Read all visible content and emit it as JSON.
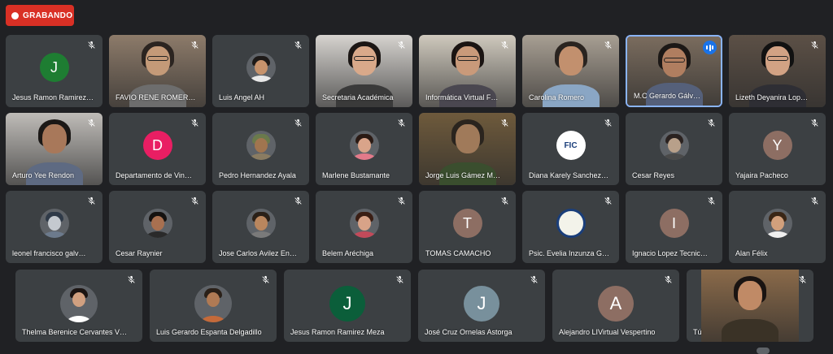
{
  "recording": {
    "label": "GRABANDO"
  },
  "participants": [
    {
      "name": "Jesus Ramon Ramirez Meza",
      "display": "Jesus Ramon Ramirez…",
      "kind": "initial",
      "initial": "J",
      "color": "#1e7d32"
    },
    {
      "name": "FAVIO RENE ROMERO",
      "display": "FAVIO RENE ROMER…",
      "kind": "video",
      "bg": "#8d7b6a",
      "skin": "#c49a78",
      "hair": "#2b2420",
      "shirt": "#6d6d6d",
      "glasses": true
    },
    {
      "name": "Luis Angel AH",
      "display": "Luis Angel AH",
      "kind": "photo",
      "skin": "#c7936c",
      "hair": "#1e1a18",
      "shirt": "#e8e8e8"
    },
    {
      "name": "Secretaria Académica",
      "display": "Secretaria Académica",
      "kind": "video",
      "bg": "#d6d3cf",
      "skin": "#d9a98a",
      "hair": "#1b1614",
      "shirt": "#3a3a3a",
      "glasses": true
    },
    {
      "name": "Informática Virtual F",
      "display": "Informática Virtual F…",
      "kind": "video",
      "bg": "#cfc9bd",
      "skin": "#c99a7a",
      "hair": "#1a1412",
      "shirt": "#4a4750",
      "glasses": true
    },
    {
      "name": "Carolina Romero",
      "display": "Carolina Romero",
      "kind": "video",
      "bg": "#a89f93",
      "skin": "#c2906e",
      "hair": "#2a2420",
      "shirt": "#8aa6c4",
      "glasses": false
    },
    {
      "name": "M.C Gerardo Gálvez",
      "display": "M.C Gerardo Gálv…",
      "kind": "video",
      "bg": "#7a6c5e",
      "skin": "#b07e60",
      "hair": "#1c1816",
      "shirt": "#55607a",
      "glasses": true,
      "speaking": true
    },
    {
      "name": "Lizeth Deyanira Lopez",
      "display": "Lizeth Deyanira Lop…",
      "kind": "video",
      "bg": "#5c5046",
      "skin": "#d2a284",
      "hair": "#111",
      "shirt": "#2e2e34",
      "glasses": true
    },
    {
      "name": "Arturo Yee Rendon",
      "display": "Arturo Yee Rendon",
      "kind": "video",
      "bg": "#bfbcb8",
      "skin": "#a8785a",
      "hair": "#1b1816",
      "shirt": "#5e6a82",
      "glasses": false
    },
    {
      "name": "Departamento de Vinculación",
      "display": "Departamento de Vin…",
      "kind": "initial",
      "initial": "D",
      "color": "#e91e63"
    },
    {
      "name": "Pedro Hernandez Ayala",
      "display": "Pedro Hernandez Ayala",
      "kind": "photo",
      "skin": "#a0754f",
      "hair": "#6a7a4c",
      "shirt": "#8a7c62"
    },
    {
      "name": "Marlene Bustamante",
      "display": "Marlene Bustamante",
      "kind": "photo",
      "skin": "#d9a48a",
      "hair": "#2a1a14",
      "shirt": "#e37a8a"
    },
    {
      "name": "Jorge Luis Gámez M",
      "display": "Jorge Luis Gámez M…",
      "kind": "video",
      "bg": "#6e5a3c",
      "skin": "#a07a5a",
      "hair": "#2a241e",
      "shirt": "#3a4e2e",
      "glasses": false
    },
    {
      "name": "Diana Karely Sanchez",
      "display": "Diana Karely Sanchez…",
      "kind": "logo",
      "text": "FIC"
    },
    {
      "name": "Cesar Reyes",
      "display": "Cesar Reyes",
      "kind": "photo",
      "skin": "#b8a08a",
      "hair": "#2a2220",
      "shirt": "#4a4a4a"
    },
    {
      "name": "Yajaira Pacheco",
      "display": "Yajaira Pacheco",
      "kind": "initial",
      "initial": "Y",
      "color": "#8d6e63"
    },
    {
      "name": "leonel francisco galvez",
      "display": "leonel francisco galv…",
      "kind": "photo",
      "skin": "#c4c9cf",
      "hair": "#2f3a48",
      "shirt": "#6c7a8c"
    },
    {
      "name": "Cesar Raynier",
      "display": "Cesar Raynier",
      "kind": "photo",
      "skin": "#a87050",
      "hair": "#151210",
      "shirt": "#2a2a2a"
    },
    {
      "name": "Jose Carlos Avilez Enriquez",
      "display": "Jose Carlos Avilez En…",
      "kind": "photo",
      "skin": "#b9865e",
      "hair": "#2a2018",
      "shirt": "#7a7a7a"
    },
    {
      "name": "Belem Aréchiga",
      "display": "Belem Aréchiga",
      "kind": "photo",
      "skin": "#d8a388",
      "hair": "#3a1e14",
      "shirt": "#c24a5a"
    },
    {
      "name": "TOMAS CAMACHO",
      "display": "TOMAS CAMACHO",
      "kind": "initial",
      "initial": "T",
      "color": "#8d6e63"
    },
    {
      "name": "Psic. Evelia Inzunza G",
      "display": "Psic. Evelia Inzunza G…",
      "kind": "seal",
      "text": ""
    },
    {
      "name": "Ignacio Lopez Tecnico",
      "display": "Ignacio Lopez Tecnic…",
      "kind": "initial",
      "initial": "I",
      "color": "#8d6e63"
    },
    {
      "name": "Alan Félix",
      "display": "Alan Félix",
      "kind": "photo",
      "skin": "#d2a07c",
      "hair": "#3a2616",
      "shirt": "#efefef"
    },
    {
      "name": "Thelma Berenice Cervantes V",
      "display": "Thelma Berenice Cervantes V…",
      "kind": "photo",
      "skin": "#d1a080",
      "hair": "#1b1412",
      "shirt": "#ffffff"
    },
    {
      "name": "Luis Gerardo Espanta Delgadillo",
      "display": "Luis Gerardo Espanta Delgadillo",
      "kind": "photo",
      "skin": "#b07a54",
      "hair": "#2a2018",
      "shirt": "#c46a3a"
    },
    {
      "name": "Jesus Ramon Ramirez Meza",
      "display": "Jesus Ramon Ramirez Meza",
      "kind": "initial",
      "initial": "J",
      "color": "#0b5e3a"
    },
    {
      "name": "José Cruz Ornelas Astorga",
      "display": "José Cruz Ornelas Astorga",
      "kind": "initial",
      "initial": "J",
      "color": "#78909c"
    },
    {
      "name": "Alejandro LIVirtual Vespertino",
      "display": "Alejandro LIVirtual Vespertino",
      "kind": "initial",
      "initial": "A",
      "color": "#8d6e63"
    },
    {
      "name": "Tú",
      "display": "Tú",
      "kind": "video",
      "bg": "#8a6a4a",
      "skin": "#c08a66",
      "hair": "#1a1412",
      "shirt": "#3a3226",
      "glasses": false
    }
  ],
  "icons": {
    "muted": "mic-off-icon",
    "speaking": "audio-level-icon"
  }
}
